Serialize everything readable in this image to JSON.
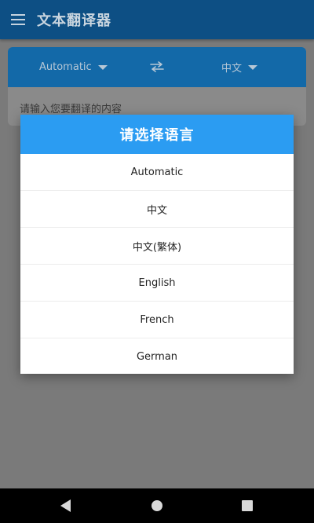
{
  "app_bar": {
    "title": "文本翻译器",
    "menu_icon": "hamburger-menu-icon"
  },
  "translator": {
    "source_language": "Automatic",
    "target_language": "中文",
    "swap_icon": "swap-arrows-icon",
    "input_placeholder": "请输入您要翻译的内容"
  },
  "dialog": {
    "title": "请选择语言",
    "options": [
      "Automatic",
      "中文",
      "中文(繁体)",
      "English",
      "French",
      "German"
    ]
  },
  "nav_bar": {
    "back_icon": "back-triangle-icon",
    "home_icon": "home-circle-icon",
    "recents_icon": "recents-square-icon"
  },
  "colors": {
    "app_bar": "#0d4f84",
    "lang_bar": "#1369a8",
    "dialog_header": "#2b9cf2",
    "scrim_background": "#7a7a7a"
  }
}
